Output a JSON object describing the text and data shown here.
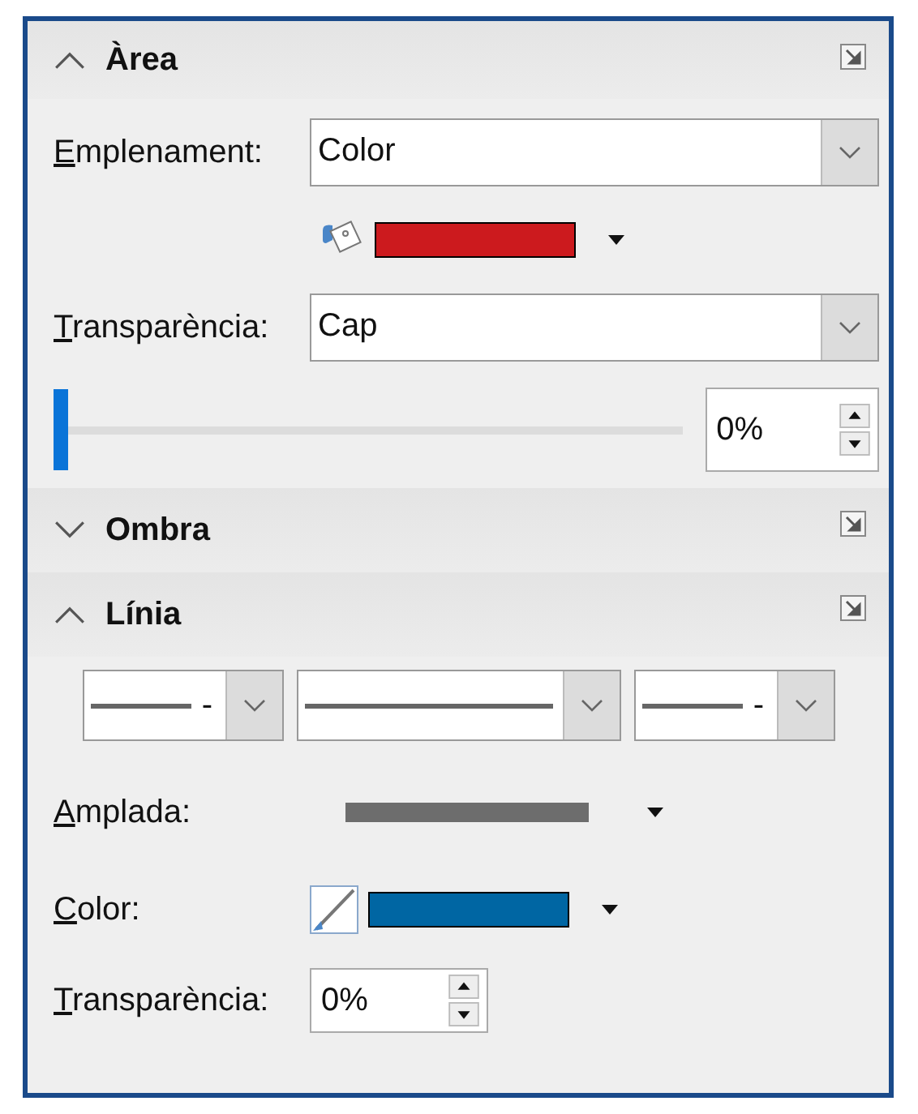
{
  "area": {
    "title": "Àrea",
    "expanded": true,
    "fill": {
      "label": "Emplenament:",
      "value": "Color"
    },
    "fill_swatch": {
      "color": "#cc1a1e"
    },
    "transparency": {
      "label": "Transparència:",
      "value": "Cap"
    },
    "slider": {
      "level": 0,
      "value": "0%"
    }
  },
  "shadow": {
    "title": "Ombra",
    "expanded": false
  },
  "line": {
    "title": "Línia",
    "expanded": true,
    "styles": [
      {
        "wide": false,
        "text": "-"
      },
      {
        "wide": true
      },
      {
        "wide": false,
        "text": "-"
      }
    ],
    "width": {
      "label": "Amplada:"
    },
    "color": {
      "label": "Color:",
      "color": "#0066a3"
    },
    "transparency": {
      "label": "Transparència:",
      "value": "0%"
    }
  }
}
